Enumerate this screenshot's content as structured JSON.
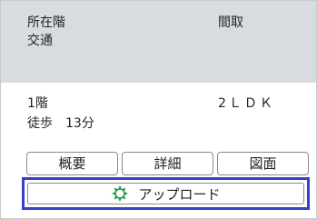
{
  "header": {
    "col1_line1": "所在階",
    "col1_line2": "交通",
    "col2": "間取"
  },
  "details": {
    "floor": "1階",
    "access": "徒歩　13分",
    "layout": "2ＬＤＫ"
  },
  "buttons": {
    "overview": "概要",
    "detail": "詳細",
    "floor_plan": "図面",
    "upload": "アップロード"
  },
  "colors": {
    "header_bg": "#d8dbe0",
    "focus_border": "#3640c8",
    "upload_icon": "#2a9d4a"
  },
  "icons": {
    "upload": "loading-spinner-icon"
  }
}
